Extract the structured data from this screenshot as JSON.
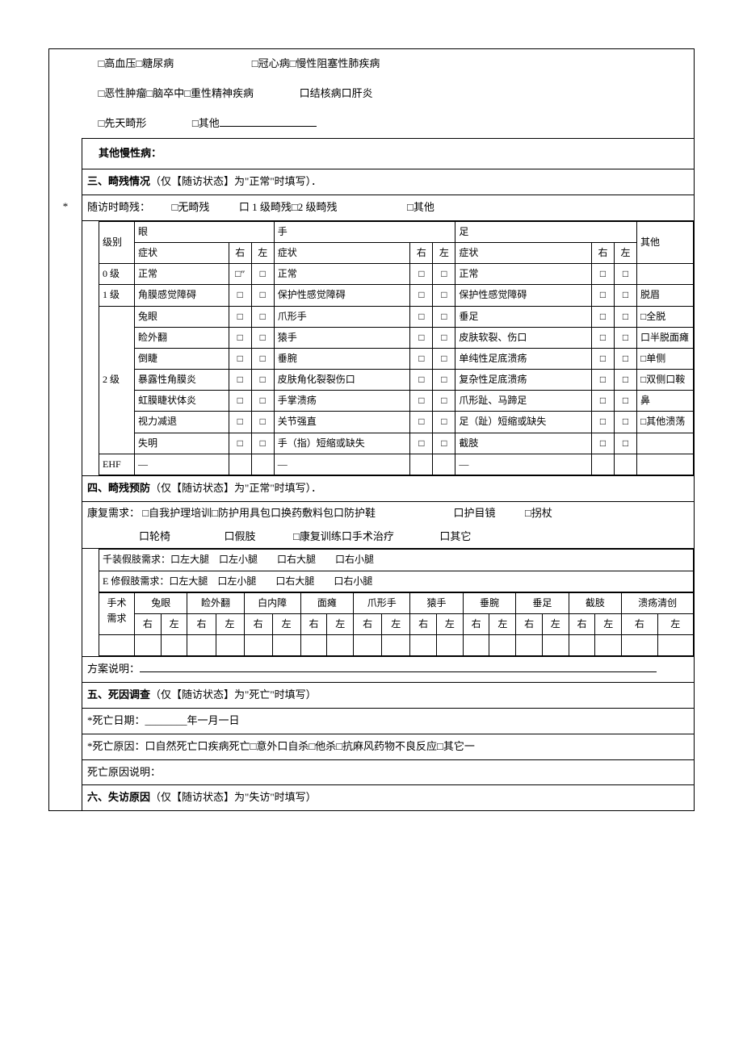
{
  "chronic": {
    "line1": {
      "opt1": "□高血压□糖尿病",
      "opt2": "□冠心病□慢性阻塞性肺疾病"
    },
    "line2": {
      "opt1": "□恶性肿瘤□脑卒中□重性精神疾病",
      "opt2": "口结核病口肝炎"
    },
    "line3": {
      "opt1": "□先天畸形",
      "opt2": "□其他"
    },
    "other_label": "其他慢性病："
  },
  "s3": {
    "title": "三、畸残情况",
    "hint": "（仅【随访状态】为\"正常\"时填写）．",
    "visit_label": "随访时畸残：",
    "visit_opts": {
      "none": "□无畸残",
      "l1": "口 1 级畸残□2 级畸残",
      "other": "□其他"
    },
    "head": {
      "level": "级别",
      "eye": "眼",
      "hand": "手",
      "foot": "足",
      "other": "其他",
      "symptom": "症状",
      "right": "右",
      "left": "左"
    },
    "rows": [
      {
        "level": "0 级",
        "eye": "正常",
        "eye_r": "□″",
        "eye_l": "□",
        "hand": "正常",
        "hand_r": "□",
        "hand_l": "□",
        "foot": "正常",
        "foot_r": "□",
        "foot_l": "□",
        "other": ""
      },
      {
        "level": "1 级",
        "eye": "角膜感觉障碍",
        "eye_r": "□",
        "eye_l": "□",
        "hand": "保护性感觉障碍",
        "hand_r": "□",
        "hand_l": "□",
        "foot": "保护性感觉障碍",
        "foot_r": "□",
        "foot_l": "□",
        "other": "脱眉"
      },
      {
        "level": "",
        "eye": "兔眼",
        "eye_r": "□",
        "eye_l": "□",
        "hand": "爪形手",
        "hand_r": "□",
        "hand_l": "□",
        "foot": "垂足",
        "foot_r": "□",
        "foot_l": "□",
        "other": "□全脱"
      },
      {
        "level": "",
        "eye": "睑外翻",
        "eye_r": "□",
        "eye_l": "□",
        "hand": "猿手",
        "hand_r": "□",
        "hand_l": "□",
        "foot": "皮肤软裂、伤口",
        "foot_r": "□",
        "foot_l": "□",
        "other": "口半脱面瘫"
      },
      {
        "level": "",
        "eye": "倒睫",
        "eye_r": "□",
        "eye_l": "□",
        "hand": "垂腕",
        "hand_r": "□",
        "hand_l": "□",
        "foot": "单纯性足底溃疡",
        "foot_r": "□",
        "foot_l": "□",
        "other": "□单侧"
      },
      {
        "level": "2 级",
        "eye": "暴露性角膜炎",
        "eye_r": "□",
        "eye_l": "□",
        "hand": "皮肤角化裂裂伤口",
        "hand_r": "□",
        "hand_l": "□",
        "foot": "复杂性足底溃疡",
        "foot_r": "□",
        "foot_l": "□",
        "other": "□双侧口鞍"
      },
      {
        "level": "",
        "eye": "虹膜睫状体炎",
        "eye_r": "□",
        "eye_l": "□",
        "hand": "手掌溃疡",
        "hand_r": "□",
        "hand_l": "□",
        "foot": "爪形趾、马蹄足",
        "foot_r": "□",
        "foot_l": "□",
        "other": "鼻"
      },
      {
        "level": "",
        "eye": "视力减退",
        "eye_r": "□",
        "eye_l": "□",
        "hand": "关节强直",
        "hand_r": "□",
        "hand_l": "□",
        "foot": "足（趾）短缩或缺失",
        "foot_r": "□",
        "foot_l": "□",
        "other": "□其他溃荡"
      },
      {
        "level": "",
        "eye": "失明",
        "eye_r": "□",
        "eye_l": "□",
        "hand": "手（指）短缩或缺失",
        "hand_r": "□",
        "hand_l": "□",
        "foot": "截肢",
        "foot_r": "□",
        "foot_l": "□",
        "other": ""
      }
    ],
    "ehf": {
      "label": "EHF",
      "dash": "—"
    }
  },
  "s4": {
    "title": "四、畸残预防",
    "hint": "（仅【随访状态】为\"正常\"时填写）．",
    "need_label": "康复需求：",
    "need_line1": "□自我护理培训□防护用具包口换药敷料包口防护鞋",
    "need_line1b": "口护目镜",
    "need_line1c": "□拐杖",
    "need_line2a": "口轮椅",
    "need_line2b": "口假肢",
    "need_line2c": "□康复训练口手术治疗",
    "need_line2d": "口其它",
    "prosth1": "千装假肢需求：口左大腿　口左小腿　　口右大腿　　口右小腿",
    "prosth2": "E 修假肢需求：口左大腿　口左小腿　　口右大腿　　口右小腿",
    "surgery_label": "手术",
    "surgery_label2": "需求",
    "surgery_cols": [
      "兔眼",
      "睑外翻",
      "白内障",
      "面瘫",
      "爪形手",
      "猿手",
      "垂腕",
      "垂足",
      "截肢",
      "溃疡清创"
    ],
    "rl": {
      "r": "右",
      "l": "左"
    },
    "plan_label": "方案说明："
  },
  "s5": {
    "title": "五、死因调查",
    "hint": "（仅【随访状态】为\"死亡\"时填写）",
    "date_label": "*死亡日期：________年一月一日",
    "cause_label": "*死亡原因：口自然死亡口疾病死亡□意外口自杀□他杀□抗麻风药物不良反应□其它一",
    "desc_label": "死亡原因说明："
  },
  "s6": {
    "title": "六、失访原因",
    "hint": "（仅【随访状态】为\"失访\"时填写）"
  }
}
